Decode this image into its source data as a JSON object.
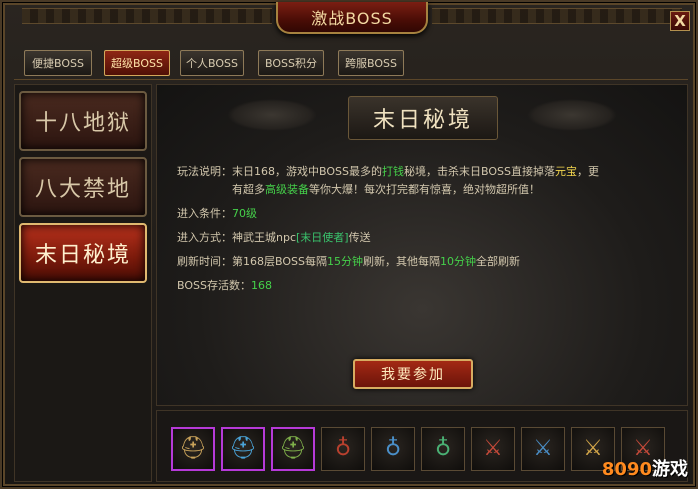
{
  "window": {
    "title": "激战BOSS",
    "close_label": "X"
  },
  "tabs": [
    {
      "label": "便捷BOSS",
      "active": false
    },
    {
      "label": "超级BOSS",
      "active": true
    },
    {
      "label": "个人BOSS",
      "active": false
    },
    {
      "label": "BOSS积分",
      "active": false
    },
    {
      "label": "跨服BOSS",
      "active": false
    }
  ],
  "categories": [
    {
      "label": "十八地狱",
      "active": false
    },
    {
      "label": "八大禁地",
      "active": false
    },
    {
      "label": "末日秘境",
      "active": true
    }
  ],
  "main": {
    "banner_title": "末日秘境",
    "rules_label": "玩法说明：",
    "rules_line1": {
      "a": "末日168，游戏中BOSS最多的",
      "b": "打钱",
      "c": "秘境，击杀末日BOSS直接掉落",
      "d": "元宝",
      "e": "，更"
    },
    "rules_line2": {
      "a": "有超多",
      "b": "高级装备",
      "c": "等你大爆！每次打完都有惊喜，绝对物超所值！"
    },
    "condition_label": "进入条件：",
    "condition_value": "70级",
    "method_label": "进入方式：",
    "method_a": "神武王城npc",
    "method_b": "[末日使者]",
    "method_c": "传送",
    "refresh_label": "刷新时间：",
    "refresh_a": "第168层BOSS每隔",
    "refresh_b": "15分钟",
    "refresh_c": "刷新，其他每隔",
    "refresh_d": "10分钟",
    "refresh_e": "全部刷新",
    "alive_label": "BOSS存活数：",
    "alive_value": "168",
    "join_label": "我要参加"
  },
  "rewards": [
    {
      "icon": "helmet-icon",
      "glyph": "⛑",
      "color": "#c8a25a",
      "epic": true
    },
    {
      "icon": "helmet-icon",
      "glyph": "⛑",
      "color": "#4aa3d8",
      "epic": true
    },
    {
      "icon": "helmet-icon",
      "glyph": "⛑",
      "color": "#7fb04a",
      "epic": true
    },
    {
      "icon": "necklace-icon",
      "glyph": "♁",
      "color": "#b8402e",
      "epic": false
    },
    {
      "icon": "necklace-icon",
      "glyph": "♁",
      "color": "#4a8fc8",
      "epic": false
    },
    {
      "icon": "necklace-icon",
      "glyph": "♁",
      "color": "#4ab074",
      "epic": false
    },
    {
      "icon": "bracelet-icon",
      "glyph": "⚔",
      "color": "#c84a3a",
      "epic": false
    },
    {
      "icon": "bracelet-icon",
      "glyph": "⚔",
      "color": "#4a8fc8",
      "epic": false
    },
    {
      "icon": "ring-icon",
      "glyph": "⚔",
      "color": "#d6a84a",
      "epic": false
    },
    {
      "icon": "ring-icon",
      "glyph": "⚔",
      "color": "#c84a3a",
      "epic": false
    }
  ],
  "watermark": {
    "num": "8090",
    "text": "游戏"
  }
}
